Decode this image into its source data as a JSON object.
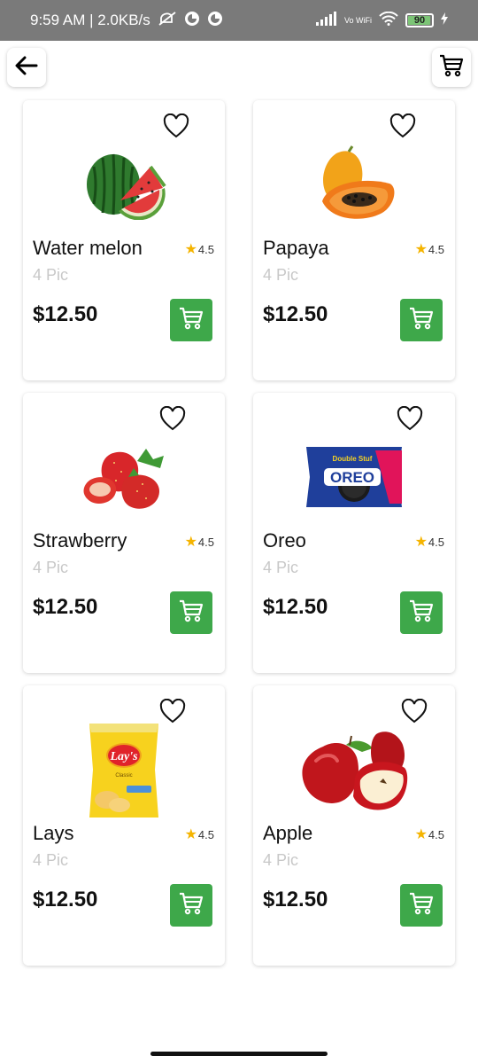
{
  "status_bar": {
    "time_speed": "9:59 AM | 2.0KB/s",
    "network_label": "Vo WiFi",
    "battery": "90"
  },
  "topbar": {
    "back_icon": "arrow-left-icon",
    "cart_icon": "cart-icon"
  },
  "products": [
    {
      "name": "Water melon",
      "rating": "4.5",
      "quantity": "4 Pic",
      "price": "$12.50",
      "image": "watermelon"
    },
    {
      "name": "Papaya",
      "rating": "4.5",
      "quantity": "4 Pic",
      "price": "$12.50",
      "image": "papaya"
    },
    {
      "name": "Strawberry",
      "rating": "4.5",
      "quantity": "4 Pic",
      "price": "$12.50",
      "image": "strawberry"
    },
    {
      "name": "Oreo",
      "rating": "4.5",
      "quantity": "4 Pic",
      "price": "$12.50",
      "image": "oreo",
      "image_text": "OREO",
      "image_subtext": "Double Stuf"
    },
    {
      "name": "Lays",
      "rating": "4.5",
      "quantity": "4 Pic",
      "price": "$12.50",
      "image": "lays",
      "image_text": "Lay's",
      "image_subtext": "Classic"
    },
    {
      "name": "Apple",
      "rating": "4.5",
      "quantity": "4 Pic",
      "price": "$12.50",
      "image": "apple"
    }
  ],
  "colors": {
    "accent_green": "#3ea84a",
    "star": "#f5b400",
    "muted_text": "#c8c8c8"
  }
}
